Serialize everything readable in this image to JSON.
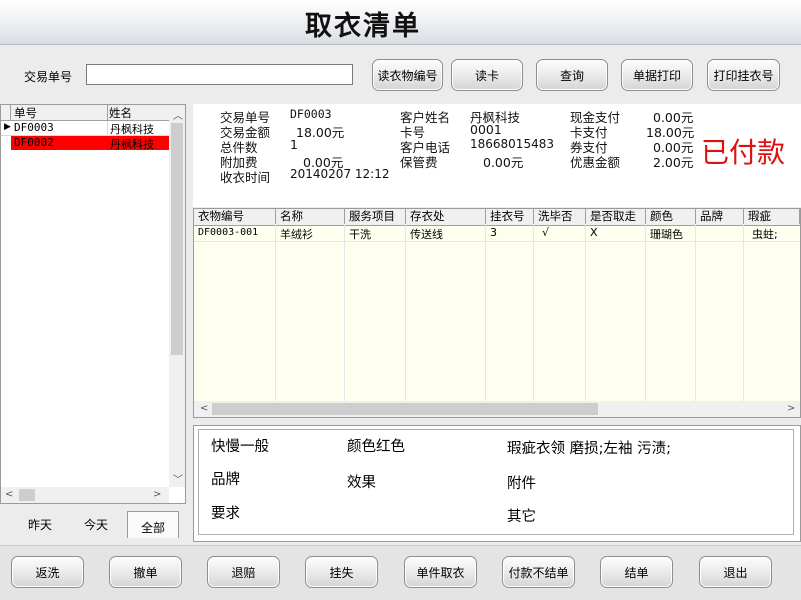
{
  "window": {
    "title": "取衣清单"
  },
  "search": {
    "label": "交易单号",
    "value": ""
  },
  "toolbar": {
    "read_clothes_id": "读衣物编号",
    "read_card": "读卡",
    "query": "查询",
    "print_receipt": "单据打印",
    "print_hang_no": "打印挂衣号"
  },
  "order_list": {
    "headers": [
      "单号",
      "姓名"
    ],
    "rows": [
      {
        "id": "DF0003",
        "name": "丹枫科技",
        "selected": false
      },
      {
        "id": "DF0002",
        "name": "丹枫科技",
        "selected": true
      }
    ]
  },
  "day_tabs": [
    "昨天",
    "今天",
    "全部"
  ],
  "day_tabs_active": "全部",
  "order_info": {
    "txn_no_label": "交易单号",
    "txn_no": "DF0003",
    "txn_amount_label": "交易金额",
    "txn_amount": "18.00元",
    "total_pieces_label": "总件数",
    "total_pieces": "1",
    "surcharge_label": "附加费",
    "surcharge": "0.00元",
    "received_time_label": "收衣时间",
    "received_time": "20140207 12:12",
    "customer_name_label": "客户姓名",
    "customer_name": "丹枫科技",
    "card_no_label": "卡号",
    "card_no": "0001",
    "customer_phone_label": "客户电话",
    "customer_phone": "18668015483",
    "storage_fee_label": "保管费",
    "storage_fee": "0.00元",
    "cash_pay_label": "现金支付",
    "cash_pay": "0.00元",
    "card_pay_label": "卡支付",
    "card_pay": "18.00元",
    "coupon_pay_label": "券支付",
    "coupon_pay": "0.00元",
    "discount_label": "优惠金额",
    "discount": "2.00元",
    "status": "已付款",
    "status_color": "#e01010"
  },
  "items_table": {
    "headers": [
      "衣物编号",
      "名称",
      "服务项目",
      "存衣处",
      "挂衣号",
      "洗毕否",
      "是否取走",
      "颜色",
      "品牌",
      "瑕疵"
    ],
    "rows": [
      [
        "DF0003-001",
        "羊绒衫",
        "干洗",
        "传送线",
        "3",
        "√",
        "X",
        "珊瑚色",
        "",
        "虫蛀;"
      ]
    ]
  },
  "details": {
    "speed": "快慢一般",
    "color": "颜色红色",
    "flaw": "瑕疵衣领 磨损;左袖 污渍;",
    "brand": "品牌",
    "effect": "效果",
    "attachment": "附件",
    "requirement": "要求",
    "other": "其它"
  },
  "bottom_buttons": [
    "返洗",
    "撤单",
    "退赔",
    "挂失",
    "单件取衣",
    "付款不结单",
    "结单",
    "退出"
  ],
  "colors": {
    "selected_row": "#ff0000",
    "grid_bg": "#fffff0"
  }
}
